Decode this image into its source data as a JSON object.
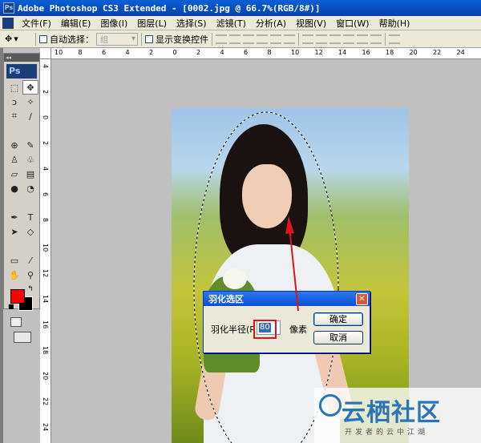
{
  "window": {
    "title": "Adobe Photoshop CS3 Extended - [0002.jpg @ 66.7%(RGB/8#)]",
    "app_icon": "Ps"
  },
  "menu": [
    "文件(F)",
    "编辑(E)",
    "图像(I)",
    "图层(L)",
    "选择(S)",
    "滤镜(T)",
    "分析(A)",
    "视图(V)",
    "窗口(W)",
    "帮助(H)"
  ],
  "options": {
    "auto_select_label": "自动选择：",
    "auto_select_value": "组",
    "show_transform_label": "显示变换控件"
  },
  "toolbox": {
    "logo": "Ps",
    "collapse": "◂◂"
  },
  "ruler": {
    "h_ticks": [
      "10",
      "8",
      "6",
      "4",
      "2",
      "0",
      "2",
      "4",
      "6",
      "8",
      "10",
      "12",
      "14",
      "16",
      "18",
      "20",
      "22",
      "24"
    ],
    "v_ticks": [
      "4",
      "2",
      "0",
      "2",
      "4",
      "6",
      "8",
      "10",
      "12",
      "14",
      "16",
      "18",
      "20",
      "22",
      "24"
    ]
  },
  "dialog": {
    "title": "羽化选区",
    "radius_label": "羽化半径(R):",
    "radius_value": "80",
    "unit": "像素",
    "ok_label": "确定",
    "cancel_label": "取消"
  },
  "watermark": {
    "main": "云栖社区",
    "sub": "开发者的云中江湖"
  },
  "colors": {
    "foreground": "#ff0000",
    "background": "#000000",
    "annotation": "#e0121b"
  }
}
